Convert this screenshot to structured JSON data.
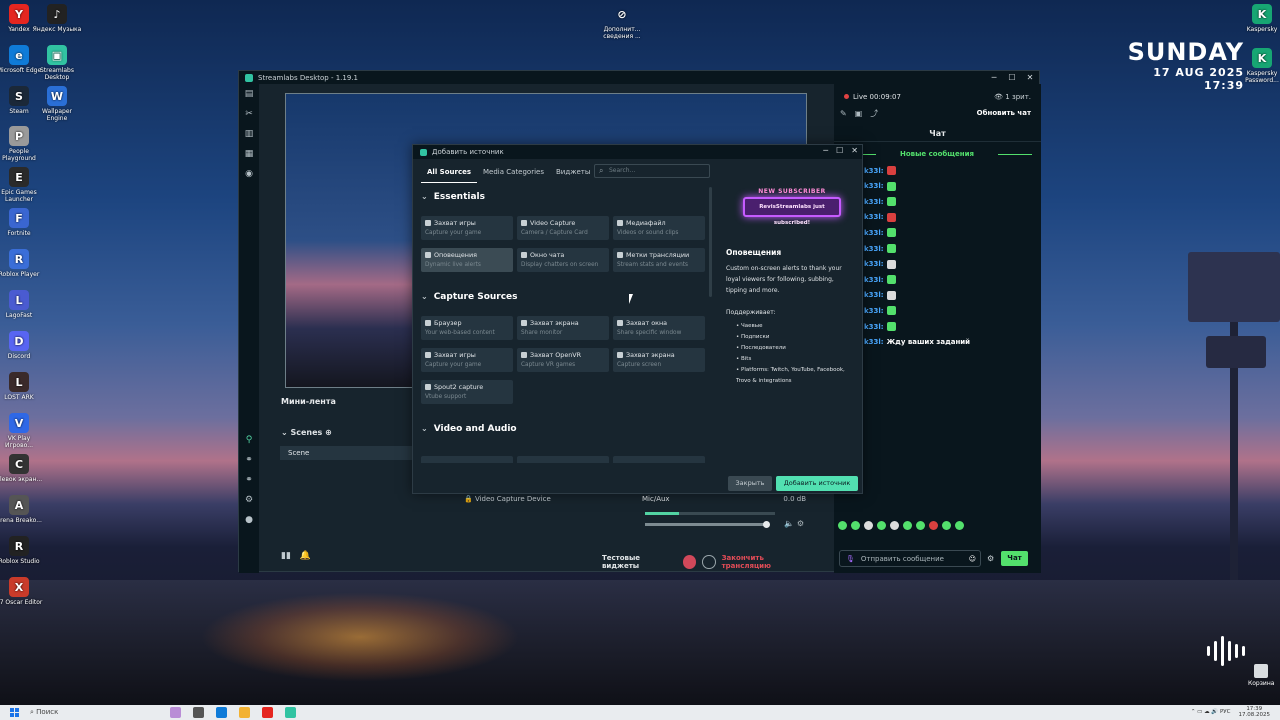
{
  "desktop": {
    "icons": [
      {
        "label": "Yandex",
        "color": "#e52620",
        "glyph": "Y"
      },
      {
        "label": "Яндекс Музыка",
        "color": "#222222",
        "glyph": "♪"
      },
      {
        "label": "Microsoft Edge",
        "color": "#0f7bd8",
        "glyph": "e"
      },
      {
        "label": "Streamlabs Desktop",
        "color": "#31c3a2",
        "glyph": "▣"
      },
      {
        "label": "Steam",
        "color": "#1b2838",
        "glyph": "S"
      },
      {
        "label": "Wallpaper Engine",
        "color": "#2a6fd6",
        "glyph": "W"
      },
      {
        "label": "People Playground",
        "color": "#9a9a9a",
        "glyph": "P"
      },
      {
        "label": "Epic Games Launcher",
        "color": "#2a2a2a",
        "glyph": "E"
      },
      {
        "label": "Fortnite",
        "color": "#3a66d1",
        "glyph": "F"
      },
      {
        "label": "Roblox Player",
        "color": "#3a6ed8",
        "glyph": "R"
      },
      {
        "label": "LagoFast",
        "color": "#4a5bd1",
        "glyph": "L"
      },
      {
        "label": "Discord",
        "color": "#5865f2",
        "glyph": "D"
      },
      {
        "label": "LOST ARK",
        "color": "#3a2a2a",
        "glyph": "L"
      },
      {
        "label": "VK Play Игрово...",
        "color": "#2f68e6",
        "glyph": "V"
      },
      {
        "label": "Clевок экран...",
        "color": "#333333",
        "glyph": "C"
      },
      {
        "label": "Arena Breako...",
        "color": "#555555",
        "glyph": "A"
      },
      {
        "label": "Roblox Studio",
        "color": "#222222",
        "glyph": "R"
      },
      {
        "label": "X7 Oscar Editor",
        "color": "#c93b2a",
        "glyph": "X"
      }
    ],
    "top_icon": {
      "label": "Дополнит... сведения ...",
      "glyph": "⊘"
    },
    "right_icons": [
      {
        "label": "Kaspersky",
        "color": "#17a673",
        "glyph": "K"
      },
      {
        "label": "Kaspersky Password...",
        "color": "#17a673",
        "glyph": "K"
      }
    ],
    "clock": {
      "day": "SUNDAY",
      "date": "17 AUG 2025",
      "time": "17:39"
    },
    "trash": {
      "label": "Корзина"
    }
  },
  "window": {
    "title": "Streamlabs Desktop - 1.19.1",
    "controls": [
      "─",
      "☐",
      "✕"
    ],
    "nav_icons": [
      "layout-icon",
      "tools-icon",
      "store-icon",
      "themes-icon",
      "dashboard-icon"
    ],
    "mini_lenta": "Мини-лента",
    "scenes_label": "Scenes",
    "scene_item": "Scene",
    "source_item": "Video Capture Device",
    "mixer": {
      "label": "Mic/Aux",
      "db": "0.0 dB",
      "level_fraction": 0.26
    },
    "footer": {
      "test_widgets": "Тестовые виджеты",
      "end_stream": "Закончить трансляцию"
    }
  },
  "chat": {
    "live": "Live 00:09:07",
    "viewers": "1 зрит.",
    "refresh": "Обновить чат",
    "title": "Чат",
    "new_messages": "Новые сообщения",
    "username": "k33l:",
    "lines": [
      {
        "emote": "#d9403f"
      },
      {
        "emote": "#53e06c"
      },
      {
        "emote": "#53e06c"
      },
      {
        "emote": "#d9403f"
      },
      {
        "emote": "#53e06c"
      },
      {
        "emote": "#53e06c"
      },
      {
        "emote": "#dcdcdc"
      },
      {
        "emote": "#53e06c"
      },
      {
        "emote": "#dcdcdc"
      },
      {
        "emote": "#53e06c"
      },
      {
        "emote": "#53e06c"
      }
    ],
    "last_message": "Жду ваших заданий",
    "emote_colors": [
      "#53e06c",
      "#53e06c",
      "#dcdcdc",
      "#53e06c",
      "#dcdcdc",
      "#53e06c",
      "#53e06c",
      "#d9403f",
      "#53e06c",
      "#53e06c"
    ],
    "placeholder": "Отправить сообщение",
    "send": "Чат"
  },
  "modal": {
    "title": "Добавить источник",
    "controls": [
      "─",
      "☐",
      "✕"
    ],
    "tabs": [
      "All Sources",
      "Media Categories",
      "Виджеты"
    ],
    "search_placeholder": "Search...",
    "sections": [
      {
        "title": "Essentials",
        "cards": [
          {
            "title": "Захват игры",
            "sub": "Capture your game",
            "selected": false
          },
          {
            "title": "Video Capture",
            "sub": "Camera / Capture Card",
            "selected": false
          },
          {
            "title": "Медиафайл",
            "sub": "Videos or sound clips",
            "selected": false
          },
          {
            "title": "Оповещения",
            "sub": "Dynamic live alerts",
            "selected": true
          },
          {
            "title": "Окно чата",
            "sub": "Display chatters on screen",
            "selected": false
          },
          {
            "title": "Метки трансляции",
            "sub": "Stream stats and events",
            "selected": false
          }
        ]
      },
      {
        "title": "Capture Sources",
        "cards": [
          {
            "title": "Браузер",
            "sub": "Your web-based content",
            "selected": false
          },
          {
            "title": "Захват экрана",
            "sub": "Share monitor",
            "selected": false
          },
          {
            "title": "Захват окна",
            "sub": "Share specific window",
            "selected": false
          },
          {
            "title": "Захват игры",
            "sub": "Capture your game",
            "selected": false
          },
          {
            "title": "Захват OpenVR",
            "sub": "Capture VR games",
            "selected": false
          },
          {
            "title": "Захват экрана",
            "sub": "Capture screen",
            "selected": false
          },
          {
            "title": "Spout2 capture",
            "sub": "Vtube support",
            "selected": false
          }
        ]
      },
      {
        "title": "Video and Audio",
        "cards": []
      }
    ],
    "preview": {
      "alert_top": "NEW SUBSCRIBER",
      "alert_text": "RevisStreamlabs just subscribed!",
      "title": "Оповещения",
      "description": "Custom on-screen alerts to thank your loyal viewers for following, subbing, tipping and more.",
      "supports_label": "Поддерживает:",
      "supports": [
        "Чаевые",
        "Подписки",
        "Последователи",
        "Bits",
        "Platforms: Twitch, YouTube, Facebook, Trovo & integrations"
      ]
    },
    "close": "Закрыть",
    "add": "Добавить источник"
  },
  "taskbar": {
    "search": "Поиск",
    "app_colors": [
      "#b98dd6",
      "#555555",
      "#0f7bd8",
      "#f2b233",
      "#e52620",
      "#31c3a2"
    ],
    "tray": [
      "⌃",
      "▭",
      "☁",
      "🔊",
      "РУС"
    ],
    "time": "17:39",
    "date": "17.08.2025"
  }
}
